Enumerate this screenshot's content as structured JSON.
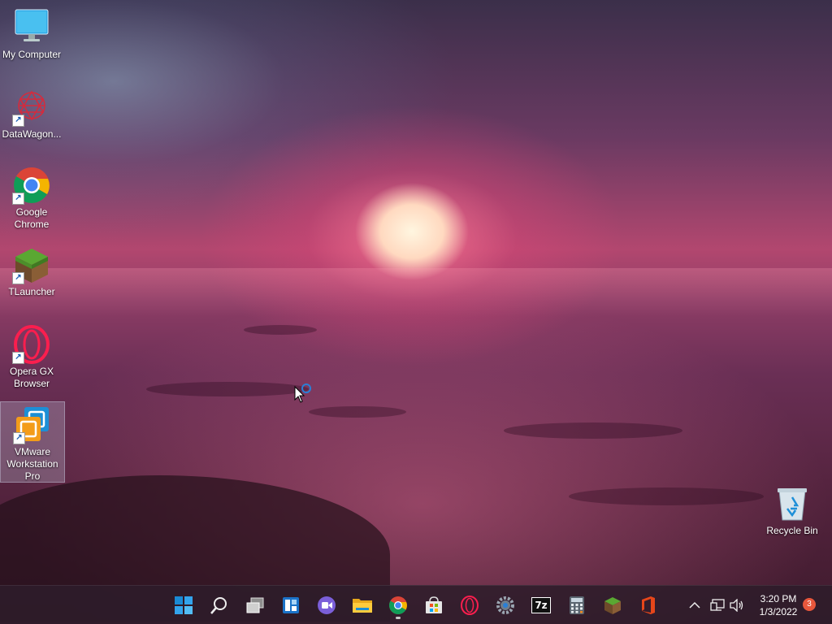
{
  "desktop_icons": [
    {
      "label": "My Computer",
      "icon": "monitor-icon"
    },
    {
      "label": "DataWagon...",
      "icon": "datawagon-icon"
    },
    {
      "label": "Google Chrome",
      "icon": "chrome-icon"
    },
    {
      "label": "TLauncher",
      "icon": "grass-block-icon"
    },
    {
      "label": "Opera GX Browser",
      "icon": "opera-icon"
    },
    {
      "label": "VMware Workstation Pro",
      "icon": "vmware-icon"
    },
    {
      "label": "Recycle Bin",
      "icon": "recycle-bin-icon"
    }
  ],
  "shortcut_arrow": "↗",
  "taskbar": {
    "apps": [
      {
        "name": "Start",
        "icon": "windows-start-icon"
      },
      {
        "name": "Search",
        "icon": "search-icon"
      },
      {
        "name": "Task View",
        "icon": "task-view-icon"
      },
      {
        "name": "Widgets",
        "icon": "widgets-icon"
      },
      {
        "name": "Chat",
        "icon": "chat-icon"
      },
      {
        "name": "File Explorer",
        "icon": "folder-icon"
      },
      {
        "name": "Google Chrome",
        "icon": "chrome-icon"
      },
      {
        "name": "Microsoft Store",
        "icon": "store-icon"
      },
      {
        "name": "Opera GX",
        "icon": "opera-icon"
      },
      {
        "name": "Settings",
        "icon": "gear-icon"
      },
      {
        "name": "7-Zip",
        "icon": "seven-zip-icon"
      },
      {
        "name": "Calculator",
        "icon": "calculator-icon"
      },
      {
        "name": "TLauncher",
        "icon": "grass-block-icon"
      },
      {
        "name": "Office",
        "icon": "office-icon"
      }
    ],
    "seven_zip_text": "7z",
    "tray": {
      "chevron": "^",
      "network_icon": "network-icon",
      "volume_icon": "volume-icon"
    },
    "time": "3:20 PM",
    "date": "1/3/2022",
    "notification_count": "3"
  },
  "colors": {
    "accent_blue": "#1a8ad4",
    "taskbar_bg": "#2d1c2a",
    "badge": "#e8573c"
  }
}
